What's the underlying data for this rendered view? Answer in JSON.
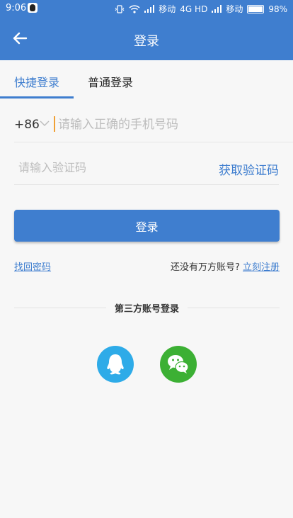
{
  "status_bar": {
    "time": "9:06",
    "carrier1": "移动",
    "network": "4G HD",
    "carrier2": "移动",
    "battery": "98%"
  },
  "header": {
    "title": "登录"
  },
  "tabs": [
    {
      "label": "快捷登录",
      "active": true
    },
    {
      "label": "普通登录",
      "active": false
    }
  ],
  "form": {
    "country_code": "+86",
    "phone_placeholder": "请输入正确的手机号码",
    "code_placeholder": "请输入验证码",
    "get_code_label": "获取验证码",
    "login_label": "登录"
  },
  "links": {
    "forgot_password": "找回密码",
    "no_account_text": "还没有万方账号?",
    "register": "立刻注册"
  },
  "third_party": {
    "label": "第三方账号登录"
  },
  "colors": {
    "accent": "#3f7ecf",
    "qq": "#2eabe8",
    "wechat": "#3cb034"
  }
}
